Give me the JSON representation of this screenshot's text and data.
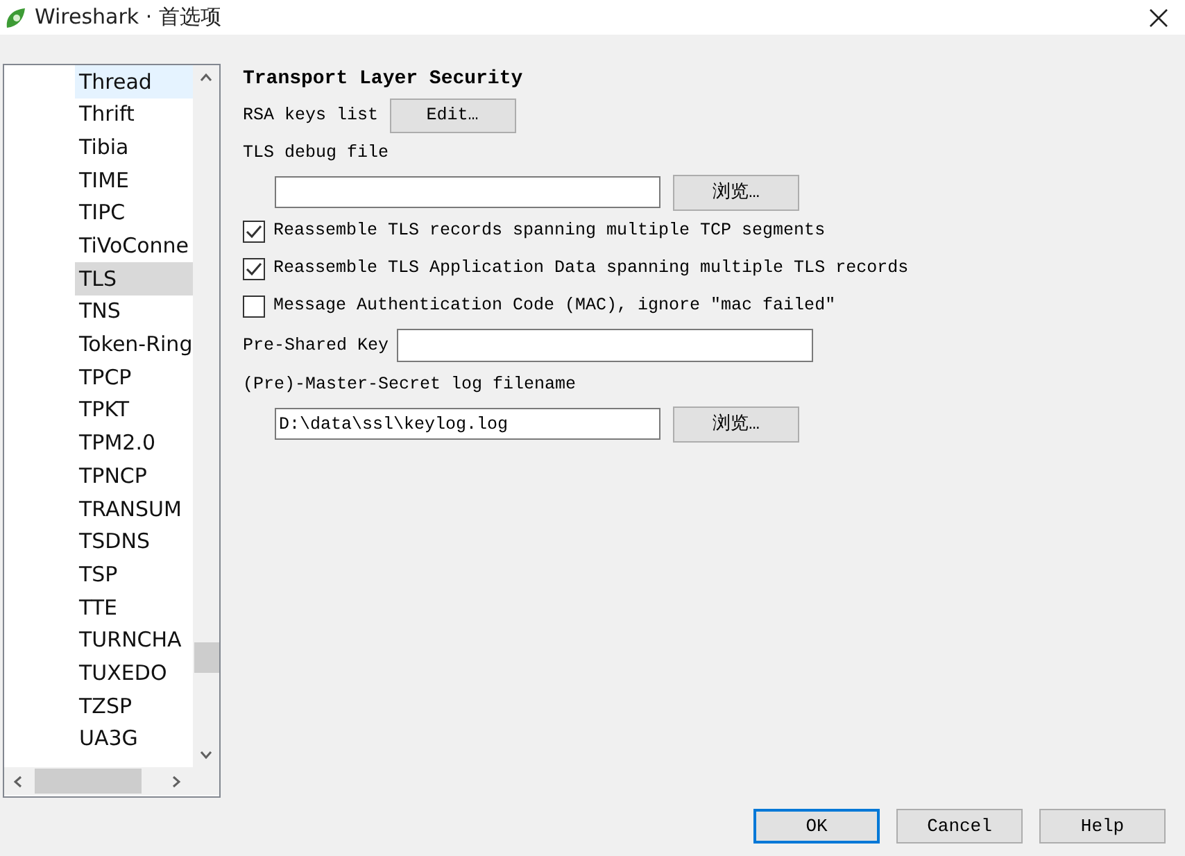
{
  "window": {
    "title": "Wireshark · 首选项"
  },
  "tree": {
    "items": [
      {
        "label": "Thread",
        "selected": false,
        "hovered": true
      },
      {
        "label": "Thrift",
        "selected": false,
        "hovered": false
      },
      {
        "label": "Tibia",
        "selected": false,
        "hovered": false
      },
      {
        "label": "TIME",
        "selected": false,
        "hovered": false
      },
      {
        "label": "TIPC",
        "selected": false,
        "hovered": false
      },
      {
        "label": "TiVoConne",
        "selected": false,
        "hovered": false
      },
      {
        "label": "TLS",
        "selected": true,
        "hovered": false
      },
      {
        "label": "TNS",
        "selected": false,
        "hovered": false
      },
      {
        "label": "Token-Ring",
        "selected": false,
        "hovered": false
      },
      {
        "label": "TPCP",
        "selected": false,
        "hovered": false
      },
      {
        "label": "TPKT",
        "selected": false,
        "hovered": false
      },
      {
        "label": "TPM2.0",
        "selected": false,
        "hovered": false
      },
      {
        "label": "TPNCP",
        "selected": false,
        "hovered": false
      },
      {
        "label": "TRANSUM",
        "selected": false,
        "hovered": false
      },
      {
        "label": "TSDNS",
        "selected": false,
        "hovered": false
      },
      {
        "label": "TSP",
        "selected": false,
        "hovered": false
      },
      {
        "label": "TTE",
        "selected": false,
        "hovered": false
      },
      {
        "label": "TURNCHA",
        "selected": false,
        "hovered": false
      },
      {
        "label": "TUXEDO",
        "selected": false,
        "hovered": false
      },
      {
        "label": "TZSP",
        "selected": false,
        "hovered": false
      },
      {
        "label": "UA3G",
        "selected": false,
        "hovered": false
      }
    ]
  },
  "panel": {
    "title": "Transport Layer Security",
    "rows": [
      {
        "kind": "button",
        "label": "RSA keys list",
        "button": "Edit…"
      },
      {
        "kind": "label",
        "label": "TLS debug file"
      },
      {
        "kind": "file",
        "value": "",
        "button": "浏览…"
      },
      {
        "kind": "checkbox",
        "label": "Reassemble TLS records spanning multiple TCP segments",
        "checked": true
      },
      {
        "kind": "checkbox",
        "label": "Reassemble TLS Application Data spanning multiple TLS records",
        "checked": true
      },
      {
        "kind": "checkbox",
        "label": "Message Authentication Code (MAC), ignore \"mac failed\"",
        "checked": false
      },
      {
        "kind": "input",
        "label": "Pre-Shared Key",
        "value": ""
      },
      {
        "kind": "label",
        "label": "(Pre)-Master-Secret log filename"
      },
      {
        "kind": "file",
        "value": "D:\\data\\ssl\\keylog.log",
        "button": "浏览…"
      }
    ]
  },
  "buttons": [
    {
      "label": "OK",
      "default": true
    },
    {
      "label": "Cancel",
      "default": false
    },
    {
      "label": "Help",
      "default": false
    }
  ]
}
